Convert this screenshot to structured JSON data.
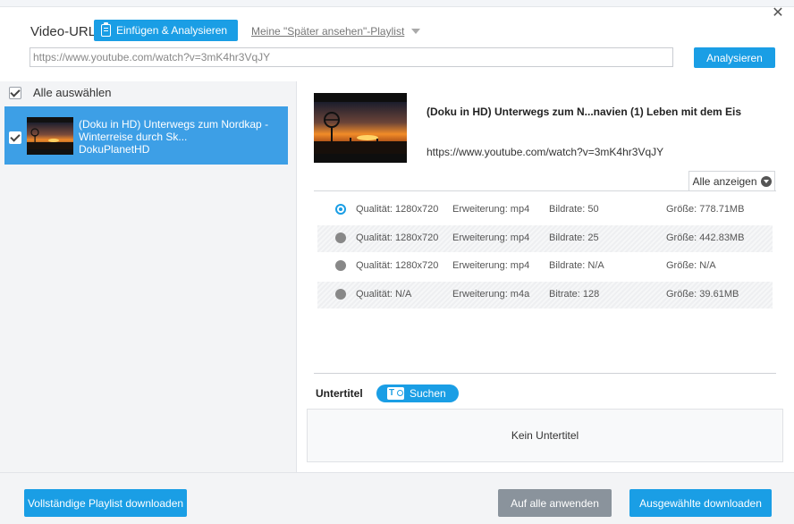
{
  "header": {
    "url_label": "Video-URL",
    "paste_button": "Einfügen & Analysieren",
    "playlist_link": "Meine \"Später ansehen\"-Playlist",
    "url_value": "https://www.youtube.com/watch?v=3mK4hr3VqJY",
    "analyze_button": "Analysieren"
  },
  "left": {
    "select_all": "Alle auswählen",
    "items": [
      {
        "line1": "(Doku in HD) Unterwegs zum Nordkap -",
        "line2": "Winterreise durch Sk...",
        "channel": "DokuPlanetHD"
      }
    ]
  },
  "detail": {
    "title": "(Doku in HD) Unterwegs zum N...navien (1) Leben mit dem Eis",
    "url": "https://www.youtube.com/watch?v=3mK4hr3VqJY",
    "show_all": "Alle anzeigen",
    "qualities": [
      {
        "quality": "Qualität: 1280x720",
        "ext": "Erweiterung: mp4",
        "bitrate": "Bildrate: 50",
        "size": "Größe: 778.71MB"
      },
      {
        "quality": "Qualität: 1280x720",
        "ext": "Erweiterung: mp4",
        "bitrate": "Bildrate: 25",
        "size": "Größe: 442.83MB"
      },
      {
        "quality": "Qualität: 1280x720",
        "ext": "Erweiterung: mp4",
        "bitrate": "Bildrate: N/A",
        "size": "Größe: N/A"
      },
      {
        "quality": "Qualität: N/A",
        "ext": "Erweiterung: m4a",
        "bitrate": "Bitrate: 128",
        "size": "Größe: 39.61MB"
      }
    ],
    "subtitle_label": "Untertitel",
    "search_button": "Suchen",
    "no_subtitle": "Kein Untertitel"
  },
  "footer": {
    "download_playlist": "Vollständige Playlist downloaden",
    "apply_all": "Auf alle anwenden",
    "download_selected": "Ausgewählte downloaden"
  },
  "colors": {
    "accent": "#1a9ee5",
    "selected_item": "#3d9fe6",
    "disabled_button": "#8a939c"
  }
}
